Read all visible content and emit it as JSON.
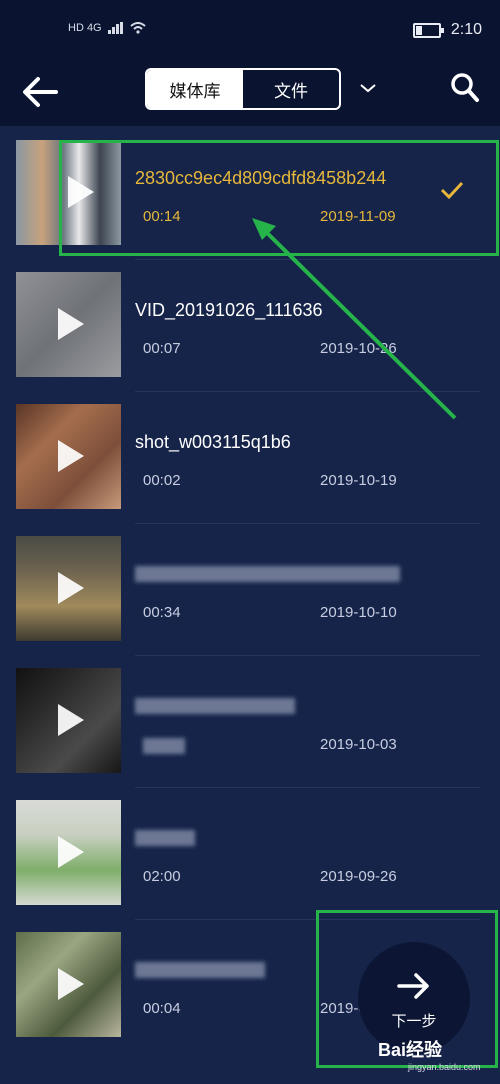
{
  "status_bar": {
    "network": "HD 4G",
    "time": "2:10"
  },
  "header": {
    "tabs": [
      "媒体库",
      "文件"
    ],
    "active_tab": 0
  },
  "videos": [
    {
      "title": "2830cc9ec4d809cdfd8458b244",
      "duration": "00:14",
      "date": "2019-11-09",
      "selected": true
    },
    {
      "title": "VID_20191026_111636",
      "duration": "00:07",
      "date": "2019-10-26"
    },
    {
      "title": "shot_w003115q1b6",
      "duration": "00:02",
      "date": "2019-10-19"
    },
    {
      "title": "",
      "duration": "00:34",
      "date": "2019-10-10"
    },
    {
      "title": "",
      "duration": "",
      "date": "2019-10-03"
    },
    {
      "title": "",
      "duration": "02:00",
      "date": "2019-09-26"
    },
    {
      "title": "",
      "duration": "00:04",
      "date": "2019-0"
    }
  ],
  "next_button": {
    "label": "下一步"
  },
  "watermark": {
    "brand": "Bai经验",
    "url": "jingyan.baidu.com"
  },
  "colors": {
    "selected": "#e6b73a",
    "annotation": "#26b34a",
    "background": "#16244a"
  }
}
